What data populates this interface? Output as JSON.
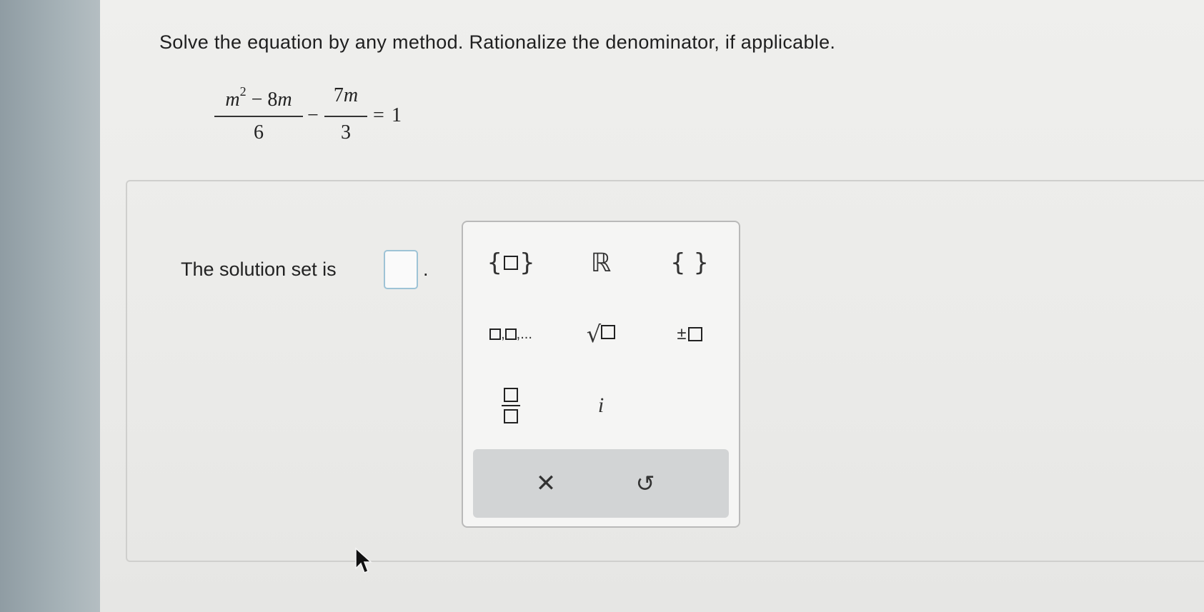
{
  "instruction": "Solve the equation by any method. Rationalize the denominator, if applicable.",
  "equation": {
    "frac1": {
      "num_var": "m",
      "num_exp": "2",
      "num_rest": "− 8",
      "num_var2": "m",
      "den": "6"
    },
    "minus": "−",
    "frac2": {
      "num": "7",
      "num_var": "m",
      "den": "3"
    },
    "equals": "=",
    "rhs": "1"
  },
  "answer": {
    "label": "The solution set is",
    "period": ".",
    "value": ""
  },
  "palette": {
    "buttons": [
      {
        "name": "set-with-element-button",
        "label": "set {□}"
      },
      {
        "name": "real-numbers-button",
        "label": "ℝ"
      },
      {
        "name": "empty-set-button",
        "label": "{ }"
      },
      {
        "name": "list-button",
        "label": "□,□,..."
      },
      {
        "name": "square-root-button",
        "label": "√□"
      },
      {
        "name": "plus-minus-button",
        "label": "±□"
      },
      {
        "name": "fraction-button",
        "label": "□/□"
      },
      {
        "name": "imaginary-unit-button",
        "label": "i"
      }
    ],
    "symbols": {
      "real": "ℝ",
      "empty_set": "{ }",
      "list_sep": ",",
      "ellipsis": "...",
      "sqrt": "√",
      "plus_minus": "±",
      "imag": "i",
      "clear": "✕",
      "undo": "↺"
    },
    "footer": {
      "clear_icon": "x-icon",
      "undo_icon": "undo-icon"
    }
  }
}
